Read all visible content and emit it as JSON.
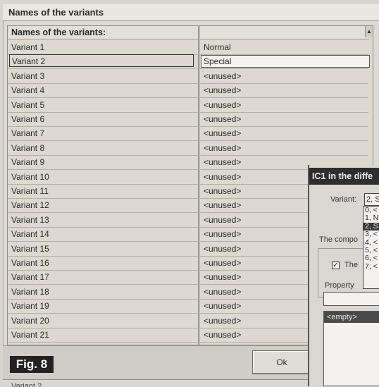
{
  "window": {
    "title": "Names of the variants"
  },
  "grid": {
    "header": "Names of the variants:",
    "scroll_up": "▲",
    "rows": [
      {
        "name": "Variant 1",
        "value": "Normal"
      },
      {
        "name": "Variant 2",
        "value": "Special"
      },
      {
        "name": "Variant 3",
        "value": "<unused>"
      },
      {
        "name": "Variant 4",
        "value": "<unused>"
      },
      {
        "name": "Variant 5",
        "value": "<unused>"
      },
      {
        "name": "Variant 6",
        "value": "<unused>"
      },
      {
        "name": "Variant 7",
        "value": "<unused>"
      },
      {
        "name": "Variant 8",
        "value": "<unused>"
      },
      {
        "name": "Variant 9",
        "value": "<unused>"
      },
      {
        "name": "Variant 10",
        "value": "<unused>"
      },
      {
        "name": "Variant 11",
        "value": "<unused>"
      },
      {
        "name": "Variant 12",
        "value": "<unused>"
      },
      {
        "name": "Variant 13",
        "value": "<unused>"
      },
      {
        "name": "Variant 14",
        "value": "<unused>"
      },
      {
        "name": "Variant 15",
        "value": "<unused>"
      },
      {
        "name": "Variant 16",
        "value": "<unused>"
      },
      {
        "name": "Variant 17",
        "value": "<unused>"
      },
      {
        "name": "Variant 18",
        "value": "<unused>"
      },
      {
        "name": "Variant 19",
        "value": "<unused>"
      },
      {
        "name": "Variant 20",
        "value": "<unused>"
      },
      {
        "name": "Variant 21",
        "value": "<unused>"
      }
    ]
  },
  "buttons": {
    "ok": "Ok"
  },
  "figure_label": "Fig. 8",
  "status_row": "Variant 2",
  "dialog": {
    "title": "IC1 in the diffe",
    "variant_label": "Variant:",
    "variant_value": "2, S",
    "dropdown_items": [
      "0, <",
      "1, N",
      "2, S",
      "3, <",
      "4, <",
      "5, <",
      "6, <",
      "7, <"
    ],
    "component_label": "The compo",
    "checkbox_label": "The",
    "checkbox_mark": "✓",
    "property_label": "Property",
    "list_empty": "<empty>"
  }
}
